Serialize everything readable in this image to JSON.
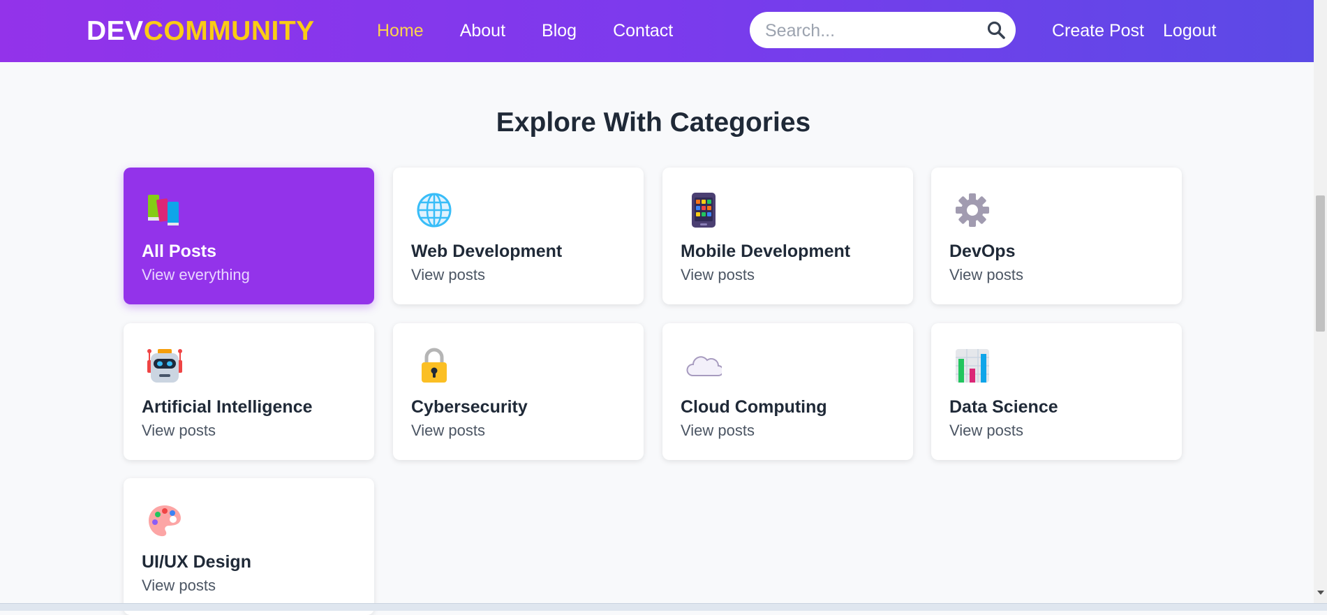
{
  "navbar": {
    "logo_part1": "DEV",
    "logo_part2": "COMMUNITY",
    "links": [
      {
        "label": "Home",
        "active": true
      },
      {
        "label": "About"
      },
      {
        "label": "Blog"
      },
      {
        "label": "Contact"
      }
    ],
    "search": {
      "placeholder": "Search...",
      "value": ""
    },
    "create_post": "Create Post",
    "logout": "Logout"
  },
  "section": {
    "title": "Explore With Categories"
  },
  "categories": [
    {
      "title": "All Posts",
      "sub": "View everything",
      "icon": "books-icon",
      "active": true
    },
    {
      "title": "Web Development",
      "sub": "View posts",
      "icon": "globe-icon"
    },
    {
      "title": "Mobile Development",
      "sub": "View posts",
      "icon": "mobile-phone-icon"
    },
    {
      "title": "DevOps",
      "sub": "View posts",
      "icon": "gear-icon"
    },
    {
      "title": "Artificial Intelligence",
      "sub": "View posts",
      "icon": "robot-icon"
    },
    {
      "title": "Cybersecurity",
      "sub": "View posts",
      "icon": "lock-icon"
    },
    {
      "title": "Cloud Computing",
      "sub": "View posts",
      "icon": "cloud-icon"
    },
    {
      "title": "Data Science",
      "sub": "View posts",
      "icon": "bar-chart-icon"
    },
    {
      "title": "UI/UX Design",
      "sub": "View posts",
      "icon": "palette-icon"
    }
  ],
  "colors": {
    "nav_gradient_start": "#9333ea",
    "nav_gradient_end": "#5b4ae6",
    "accent_yellow": "#facc15",
    "active_card": "#9333ea"
  }
}
